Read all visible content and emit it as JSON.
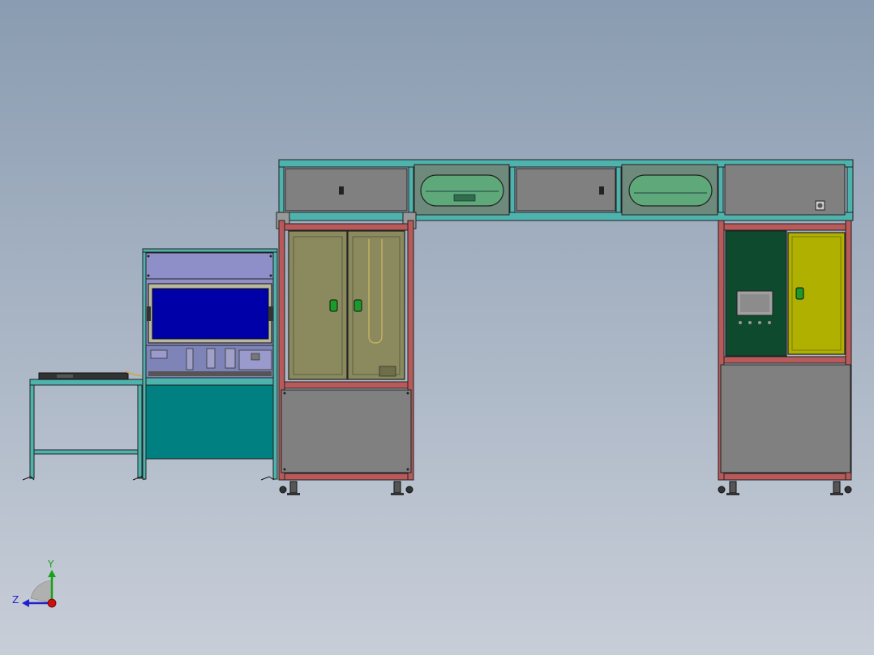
{
  "viewport": {
    "background_top": "#8a9cb1",
    "background_bottom": "#c8ced8"
  },
  "colors": {
    "teal_frame": "#4fb3ad",
    "teal_panel": "#008080",
    "red_frame": "#b85a5a",
    "gray_panel": "#808080",
    "lavender_panel": "#8e8ec8",
    "blue_screen": "#0000a8",
    "olive_door": "#8a8a5e",
    "dark_green_panel": "#0d4a2e",
    "yellow_door": "#b0b000",
    "window_green": "#5fa87a"
  },
  "triad": {
    "x_axis_label": "",
    "y_axis_label": "Y",
    "z_axis_label": "Z",
    "y_color": "#1aa01a",
    "z_color": "#2222cc",
    "x_color": "#cc1111"
  }
}
